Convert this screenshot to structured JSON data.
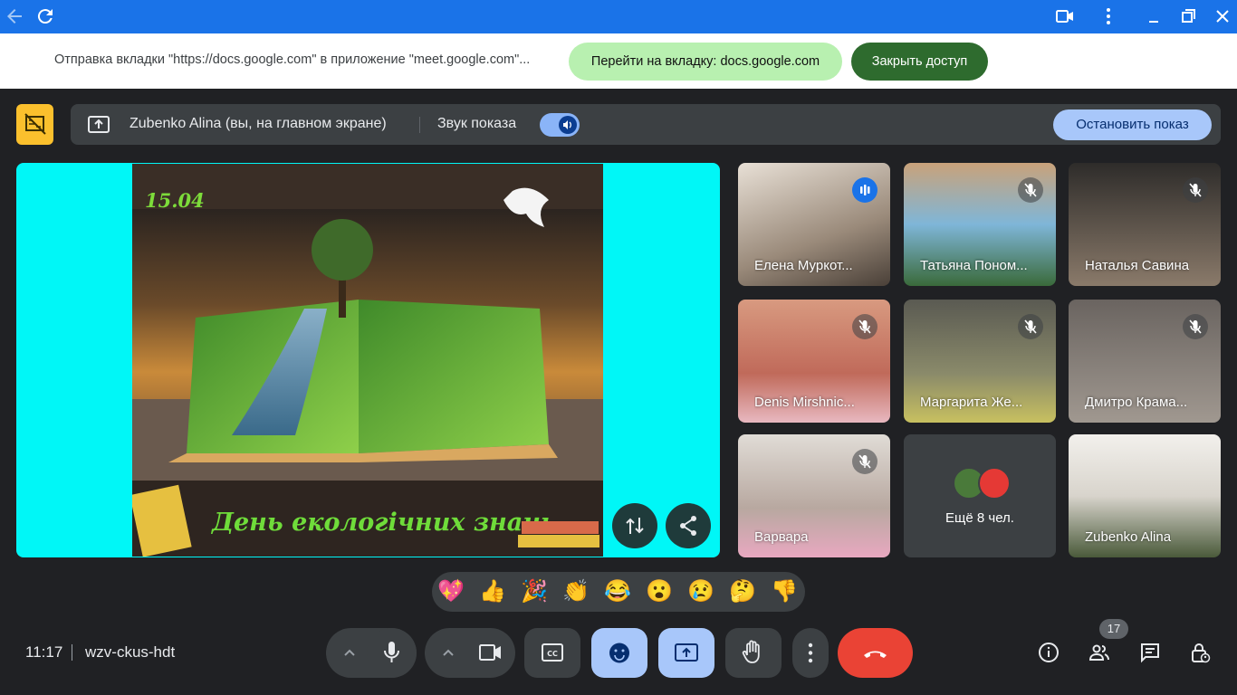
{
  "window": {
    "back_icon": "arrow-left-icon",
    "reload_icon": "reload-icon",
    "controls": [
      "video-camera-icon",
      "more-vert-icon",
      "minimize-icon",
      "restore-icon",
      "close-icon"
    ]
  },
  "infobar": {
    "text": "Отправка вкладки \"https://docs.google.com\" в приложение \"meet.google.com\"...",
    "goto_label": "Перейти на вкладку: docs.google.com",
    "close_label": "Закрыть доступ"
  },
  "presenting": {
    "presenter": "Zubenko Alina (вы, на главном экране)",
    "audio_label": "Звук показа",
    "audio_on": true,
    "stop_label": "Остановить показ"
  },
  "slide": {
    "date": "15.04",
    "title": "День екологічних знань"
  },
  "participants": [
    {
      "name": "Елена Муркот...",
      "mic": "speaking"
    },
    {
      "name": "Татьяна Поном...",
      "mic": "muted"
    },
    {
      "name": "Наталья Савина",
      "mic": "muted"
    },
    {
      "name": "Denis Mirshnic...",
      "mic": "muted"
    },
    {
      "name": "Маргарита Же...",
      "mic": "muted"
    },
    {
      "name": "Дмитро Крама...",
      "mic": "muted"
    },
    {
      "name": "Варвара",
      "mic": "muted"
    },
    {
      "name": "Ещё 8 чел.",
      "mic": "none"
    },
    {
      "name": "Zubenko Alina",
      "mic": "none"
    }
  ],
  "reactions": [
    "💖",
    "👍",
    "🎉",
    "👏",
    "😂",
    "😮",
    "😢",
    "🤔",
    "👎"
  ],
  "footer": {
    "time": "11:17",
    "meeting_code": "wzv-ckus-hdt",
    "people_count": "17"
  },
  "colors": {
    "accent_blue": "#1a73e8",
    "present_yellow": "#fbc02d",
    "end_call_red": "#ea4335",
    "active_control": "#a8c7fa"
  }
}
